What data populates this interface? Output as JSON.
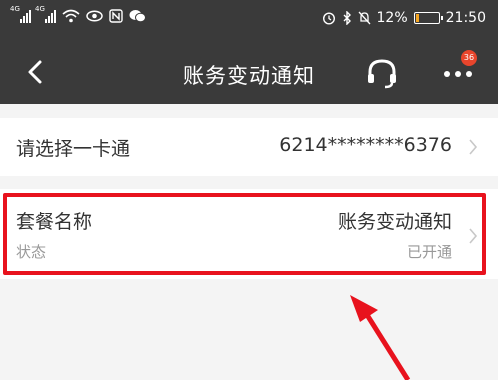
{
  "status_bar": {
    "signal1_label": "4G",
    "signal2_label": "4G",
    "battery_percent": "12%",
    "battery_level": 0.12,
    "time": "21:50"
  },
  "nav": {
    "title": "账务变动通知",
    "badge_count": "36"
  },
  "card_row": {
    "label": "请选择一卡通",
    "value": "6214********6376"
  },
  "plan_row": {
    "label": "套餐名称",
    "sublabel": "状态",
    "value": "账务变动通知",
    "status": "已开通"
  },
  "colors": {
    "header_bg": "#3a3a3a",
    "highlight": "#e8121d",
    "badge": "#e8452c"
  }
}
